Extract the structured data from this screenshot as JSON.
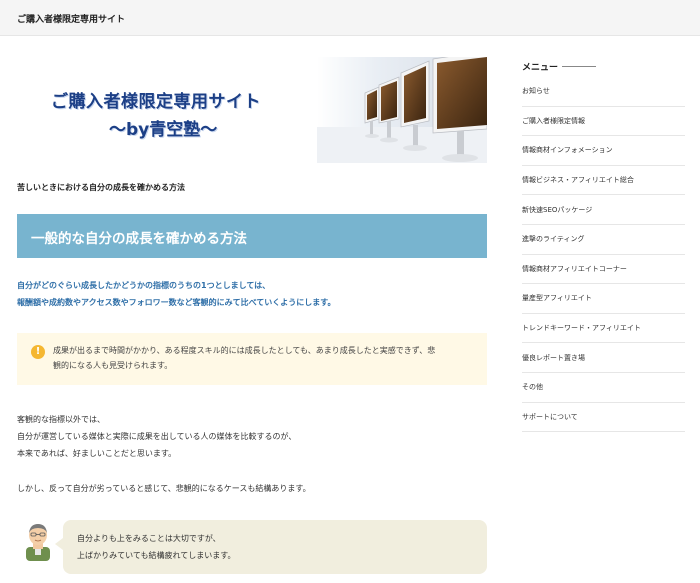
{
  "header": {
    "site_title": "ご購入者様限定専用サイト"
  },
  "banner": {
    "line1": "ご購入者様限定専用サイト",
    "line2": "～by青空塾～"
  },
  "article": {
    "subtitle": "苦しいときにおける自分の成長を確かめる方法",
    "heading": "一般的な自分の成長を確かめる方法",
    "lead": [
      "自分がどのぐらい成長したかどうかの指標のうちの1つとしましては、",
      "報酬額や成約数やアクセス数やフォロワー数など客観的にみて比べていくようにします。"
    ],
    "alert": {
      "icon": "!",
      "text": [
        "成果が出るまで時間がかかり、ある程度スキル的には成長したとしても、あまり成長したと実感できず、悲",
        "観的になる人も見受けられます。"
      ]
    },
    "para1": [
      "客観的な指標以外では、",
      "自分が運営している媒体と実際に成果を出している人の媒体を比較するのが、",
      "本来であれば、好ましいことだと思います。"
    ],
    "para2": "しかし、反って自分が劣っていると感じて、悲観的になるケースも結構あります。",
    "speech": [
      "自分よりも上をみることは大切ですが、",
      "上ばかりみていても結構疲れてしまいます。"
    ]
  },
  "sidebar": {
    "title": "メニュー",
    "items": [
      "お知らせ",
      "ご購入者様限定情報",
      "情報商材インフォメーション",
      "情報ビジネス・アフィリエイト総合",
      "新快速SEOパッケージ",
      "進撃のライティング",
      "情報商材アフィリエイトコーナー",
      "量産型アフィリエイト",
      "トレンドキーワード・アフィリエイト",
      "優良レポート置き場",
      "その他",
      "サポートについて"
    ]
  },
  "colors": {
    "heading_bg": "#78b4cf",
    "lead_text": "#2f6fa8",
    "alert_bg": "#fff9e6",
    "alert_icon": "#f5b731",
    "bubble_bg": "#f1eede",
    "banner_text": "#1c3f86"
  },
  "icons": {
    "alert": "exclamation-circle-icon",
    "avatar": "man-avatar-icon"
  }
}
